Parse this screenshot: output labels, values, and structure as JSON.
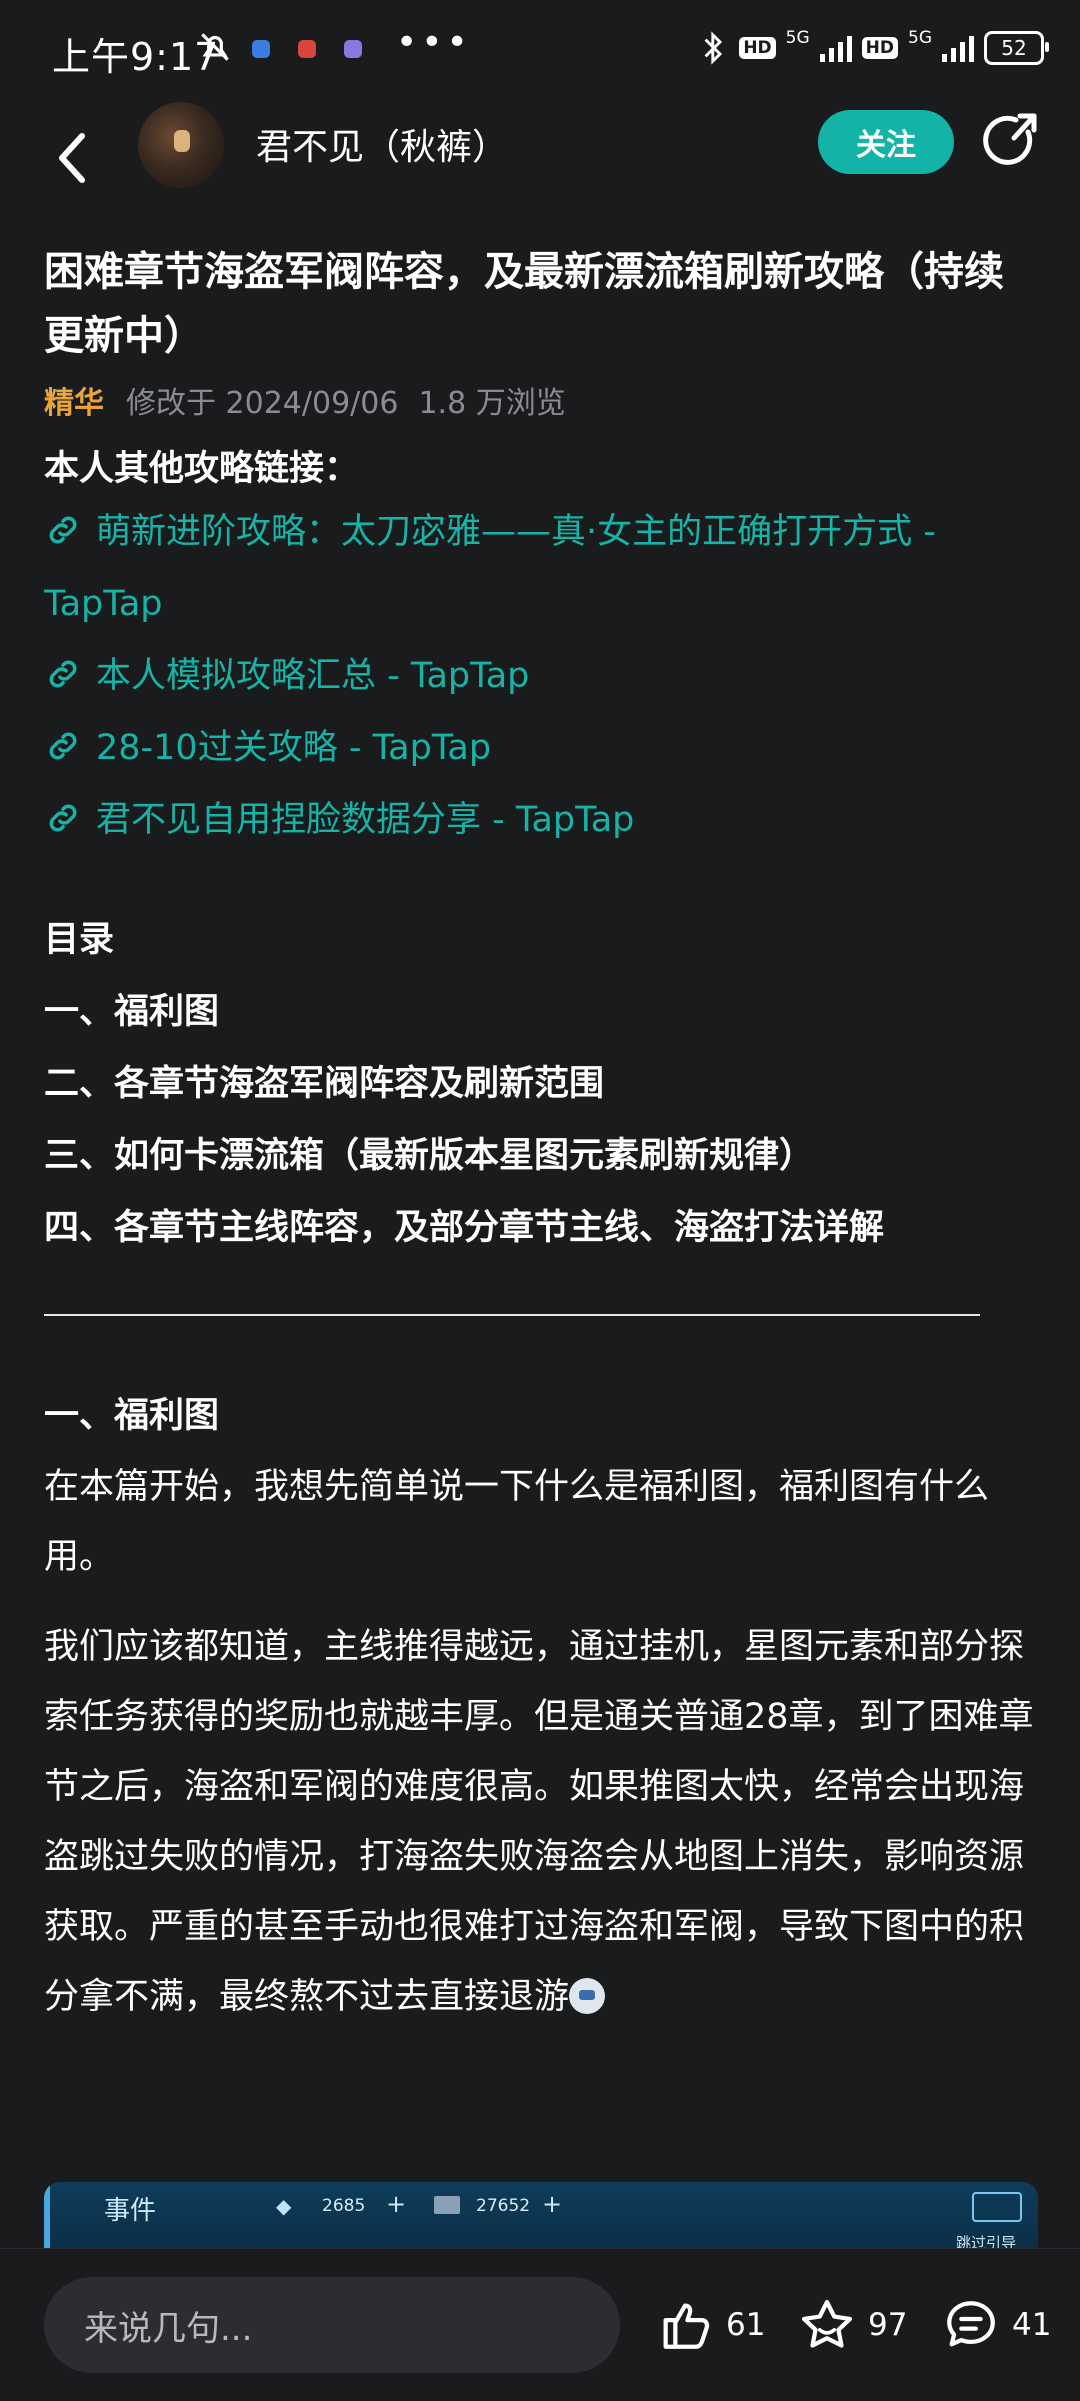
{
  "status_bar": {
    "time": "上午9:17",
    "network": "5G",
    "hd": "HD",
    "battery": "52"
  },
  "header": {
    "author": "君不见（秋裤）",
    "follow_label": "关注"
  },
  "article": {
    "title": "困难章节海盗军阀阵容，及最新漂流箱刷新攻略（持续更新中）",
    "tag": "精华",
    "modified": "修改于 2024/09/06",
    "views": "1.8 万浏览",
    "links_heading": "本人其他攻略链接：",
    "links": [
      "萌新进阶攻略：太刀宓雅——真·女主的正确打开方式 - TapTap",
      "本人模拟攻略汇总 - TapTap",
      "28-10过关攻略 - TapTap",
      "君不见自用捏脸数据分享 - TapTap"
    ],
    "toc_title": "目录",
    "toc": [
      "一、福利图",
      "二、各章节海盗军阀阵容及刷新范围",
      "三、如何卡漂流箱（最新版本星图元素刷新规律）",
      "四、各章节主线阵容，及部分章节主线、海盗打法详解"
    ],
    "section1_heading": "一、福利图",
    "para1": "在本篇开始，我想先简单说一下什么是福利图，福利图有什么用。",
    "para2": "我们应该都知道，主线推得越远，通过挂机，星图元素和部分探索任务获得的奖励也就越丰厚。但是通关普通28章，到了困难章节之后，海盗和军阀的难度很高。如果推图太快，经常会出现海盗跳过失败的情况，打海盗失败海盗会从地图上消失，影响资源获取。严重的甚至手动也很难打过海盗和军阀，导致下图中的积分拿不满，最终熬不过去直接退游"
  },
  "image_preview": {
    "title": "事件",
    "gem_value": "2685",
    "card_value": "27652",
    "skip_label": "跳过引导"
  },
  "bottom_bar": {
    "comment_placeholder": "来说几句...",
    "like_count": "61",
    "favorite_count": "97",
    "comment_count": "41"
  },
  "colors": {
    "accent": "#14b3a7",
    "link": "#16b3a6",
    "tag": "#e8a33a",
    "background": "#1a1b1d"
  }
}
